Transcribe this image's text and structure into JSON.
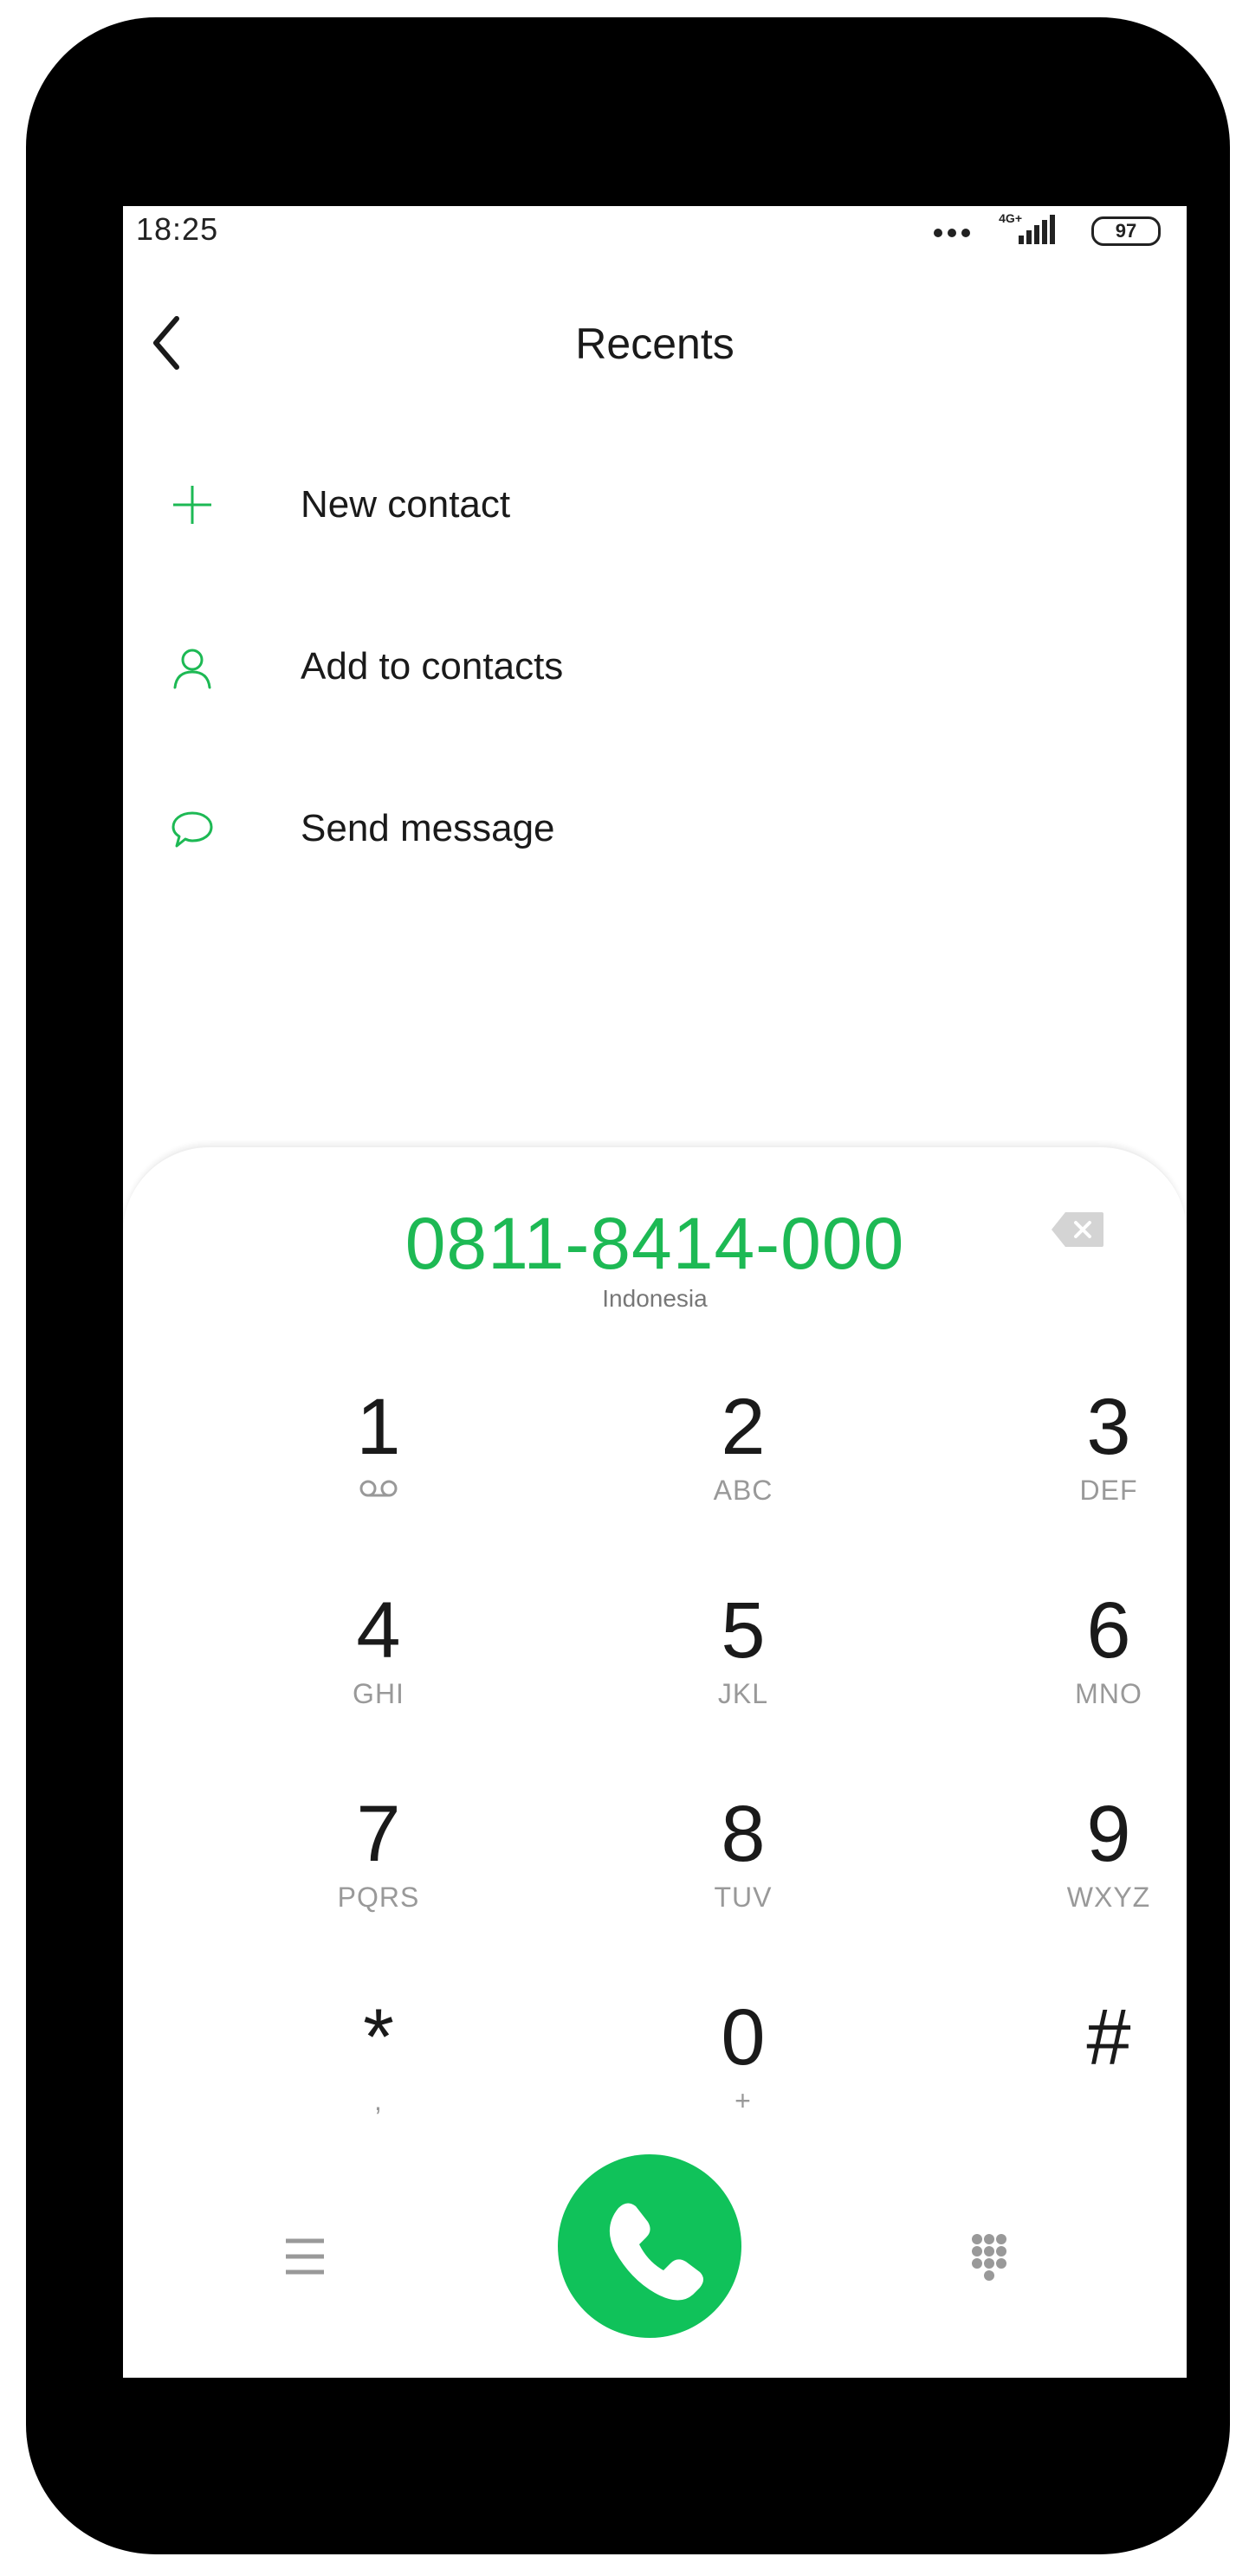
{
  "status_bar": {
    "time": "18:25",
    "network": "4G+",
    "battery": "97"
  },
  "header": {
    "title": "Recents"
  },
  "menu": {
    "items": [
      {
        "label": "New contact",
        "icon": "plus-icon"
      },
      {
        "label": "Add to contacts",
        "icon": "person-icon"
      },
      {
        "label": "Send message",
        "icon": "chat-bubble-icon"
      }
    ]
  },
  "dialer": {
    "number": "0811-8414-000",
    "region": "Indonesia",
    "keys": [
      {
        "digit": "1",
        "letters": ""
      },
      {
        "digit": "2",
        "letters": "ABC"
      },
      {
        "digit": "3",
        "letters": "DEF"
      },
      {
        "digit": "4",
        "letters": "GHI"
      },
      {
        "digit": "5",
        "letters": "JKL"
      },
      {
        "digit": "6",
        "letters": "MNO"
      },
      {
        "digit": "7",
        "letters": "PQRS"
      },
      {
        "digit": "8",
        "letters": "TUV"
      },
      {
        "digit": "9",
        "letters": "WXYZ"
      },
      {
        "digit": "*",
        "letters": ","
      },
      {
        "digit": "0",
        "letters": "+"
      },
      {
        "digit": "#",
        "letters": ""
      }
    ]
  },
  "colors": {
    "accent": "#1db954",
    "call_button": "#10c25a",
    "text": "#1a1a1a",
    "subtext": "#999999"
  }
}
